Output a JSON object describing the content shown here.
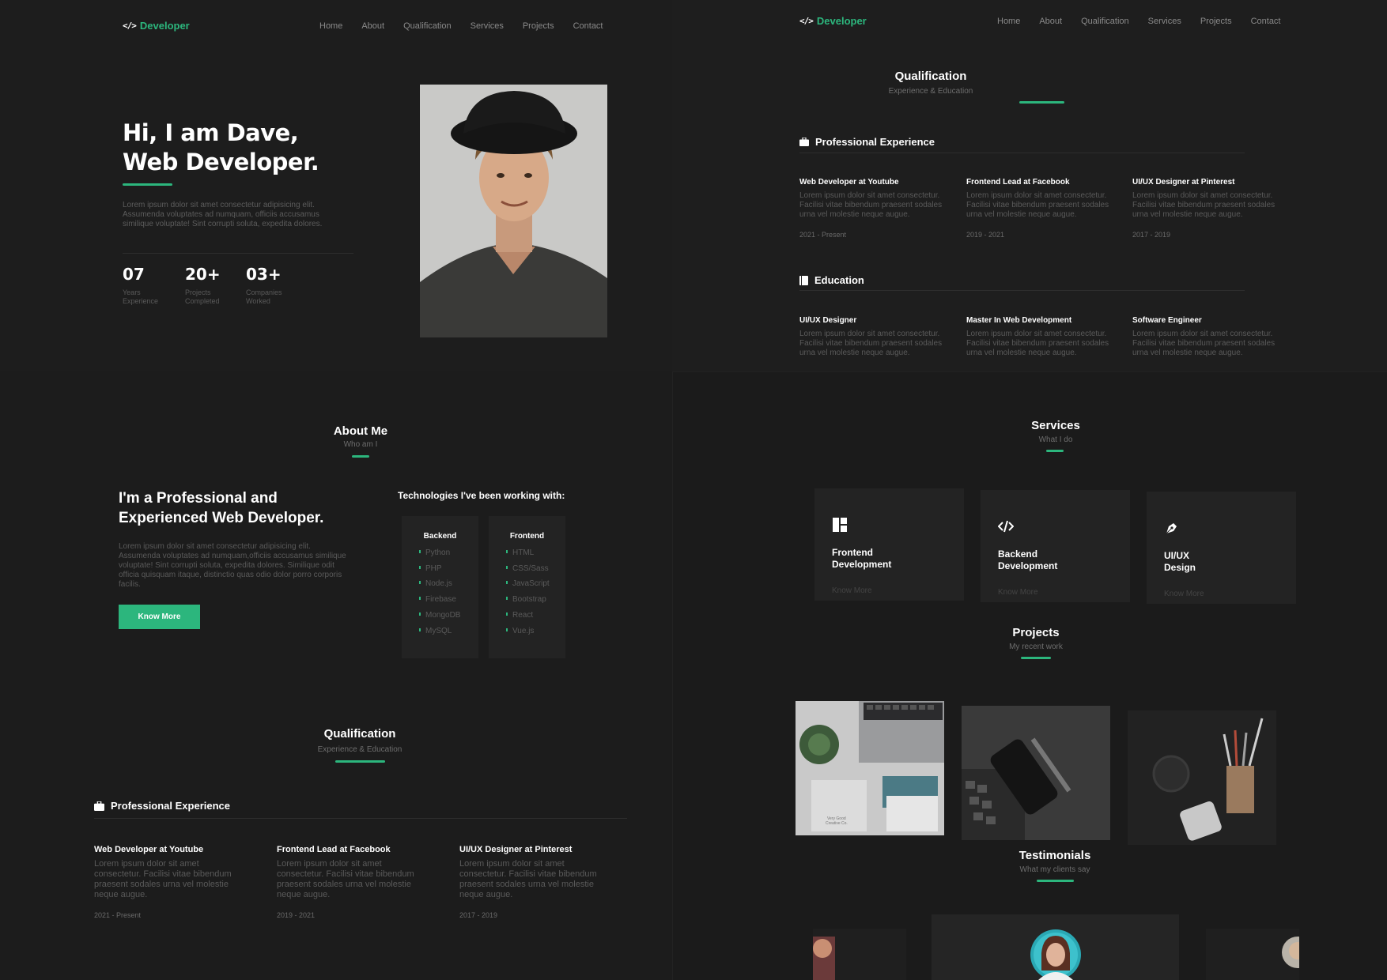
{
  "brand": {
    "logo_glyph": "</>",
    "logo_text": "Developer",
    "accent": "#2cb67d",
    "background": "#1b1b1b"
  },
  "nav": {
    "links": [
      "Home",
      "About",
      "Qualification",
      "Services",
      "Projects",
      "Contact"
    ]
  },
  "hero": {
    "title_line1": "Hi, I am Dave,",
    "title_line2": "Web Developer.",
    "description": "Lorem ipsum dolor sit amet consectetur adipisicing elit. Assumenda voluptates ad numquam, officiis accusamus similique voluptate! Sint corrupti soluta, expedita dolores.",
    "stats": [
      {
        "value": "07",
        "label_line1": "Years",
        "label_line2": "Experience"
      },
      {
        "value": "20+",
        "label_line1": "Projects",
        "label_line2": "Completed"
      },
      {
        "value": "03+",
        "label_line1": "Companies",
        "label_line2": "Worked"
      }
    ]
  },
  "qualification": {
    "title": "Qualification",
    "subtitle": "Experience & Education",
    "experience_heading": "Professional Experience",
    "experience": [
      {
        "title": "Web Developer at Youtube",
        "desc": "Lorem ipsum dolor sit amet consectetur. Facilisi vitae bibendum praesent sodales urna vel molestie neque augue.",
        "date": "2021 - Present"
      },
      {
        "title": "Frontend Lead at Facebook",
        "desc": "Lorem ipsum dolor sit amet consectetur. Facilisi vitae bibendum praesent sodales urna vel molestie neque augue.",
        "date": "2019 - 2021"
      },
      {
        "title": "UI/UX Designer at Pinterest",
        "desc": "Lorem ipsum dolor sit amet consectetur. Facilisi vitae bibendum praesent sodales urna vel molestie neque augue.",
        "date": "2017 - 2019"
      }
    ],
    "education_heading": "Education",
    "education": [
      {
        "title": "UI/UX Designer",
        "desc": "Lorem ipsum dolor sit amet consectetur. Facilisi vitae bibendum praesent sodales urna vel molestie neque augue."
      },
      {
        "title": "Master In Web Development",
        "desc": "Lorem ipsum dolor sit amet consectetur. Facilisi vitae bibendum praesent sodales urna vel molestie neque augue."
      },
      {
        "title": "Software Engineer",
        "desc": "Lorem ipsum dolor sit amet consectetur. Facilisi vitae bibendum praesent sodales urna vel molestie neque augue."
      }
    ]
  },
  "about": {
    "title": "About Me",
    "subtitle": "Who am I",
    "heading_line1": "I'm a Professional and",
    "heading_line2": "Experienced Web Developer.",
    "description": "Lorem ipsum dolor sit amet consectetur adipisicing elit. Assumenda voluptates ad numquam,officiis accusamus similique voluptate! Sint corrupti soluta, expedita dolores. Similique odit officia quisquam itaque, distinctio quas odio dolor porro corporis facilis.",
    "button": "Know More",
    "tech_heading": "Technologies I've been working with:",
    "backend": {
      "title": "Backend",
      "items": [
        "Python",
        "PHP",
        "Node.js",
        "Firebase",
        "MongoDB",
        "MySQL"
      ]
    },
    "frontend": {
      "title": "Frontend",
      "items": [
        "HTML",
        "CSS/Sass",
        "JavaScript",
        "Bootstrap",
        "React",
        "Vue.js"
      ]
    }
  },
  "services": {
    "title": "Services",
    "subtitle": "What I do",
    "cards": [
      {
        "line1": "Frontend",
        "line2": "Development",
        "link": "Know More",
        "icon": "layout-icon"
      },
      {
        "line1": "Backend",
        "line2": "Development",
        "link": "Know More",
        "icon": "code-icon"
      },
      {
        "line1": "UI/UX",
        "line2": "Design",
        "link": "Know More",
        "icon": "pen-nib-icon"
      }
    ]
  },
  "projects": {
    "title": "Projects",
    "subtitle": "My recent work",
    "card_text": [
      "Very Good",
      "Creative Co."
    ]
  },
  "testimonials": {
    "title": "Testimonials",
    "subtitle": "What my clients say"
  }
}
